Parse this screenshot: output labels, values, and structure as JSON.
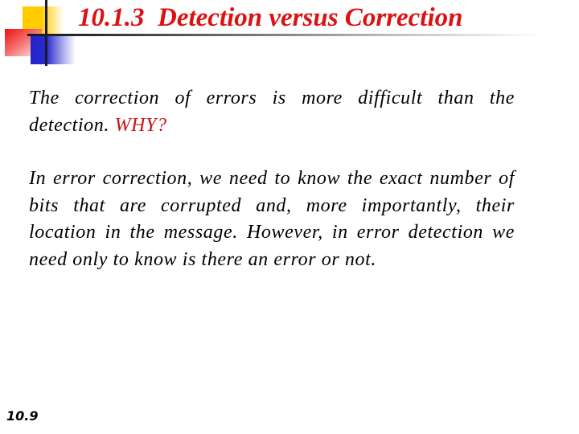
{
  "slide": {
    "title": "10.1.3  Detection versus Correction",
    "paragraphs": [
      {
        "text": "The correction of errors is more difficult than the detection. ",
        "highlight": "WHY?"
      },
      {
        "text": "In error correction, we need to know the exact number of bits that are corrupted and, more importantly, their location in the message. However, in error detection we need only to know is there an error or not."
      }
    ],
    "page_number": "10.9"
  },
  "colors": {
    "title": "#dd1111",
    "highlight": "#cc1111",
    "body_text": "#000000",
    "logo_yellow": "#ffcc00",
    "logo_red": "#ee1111",
    "logo_blue": "#2222cc"
  }
}
